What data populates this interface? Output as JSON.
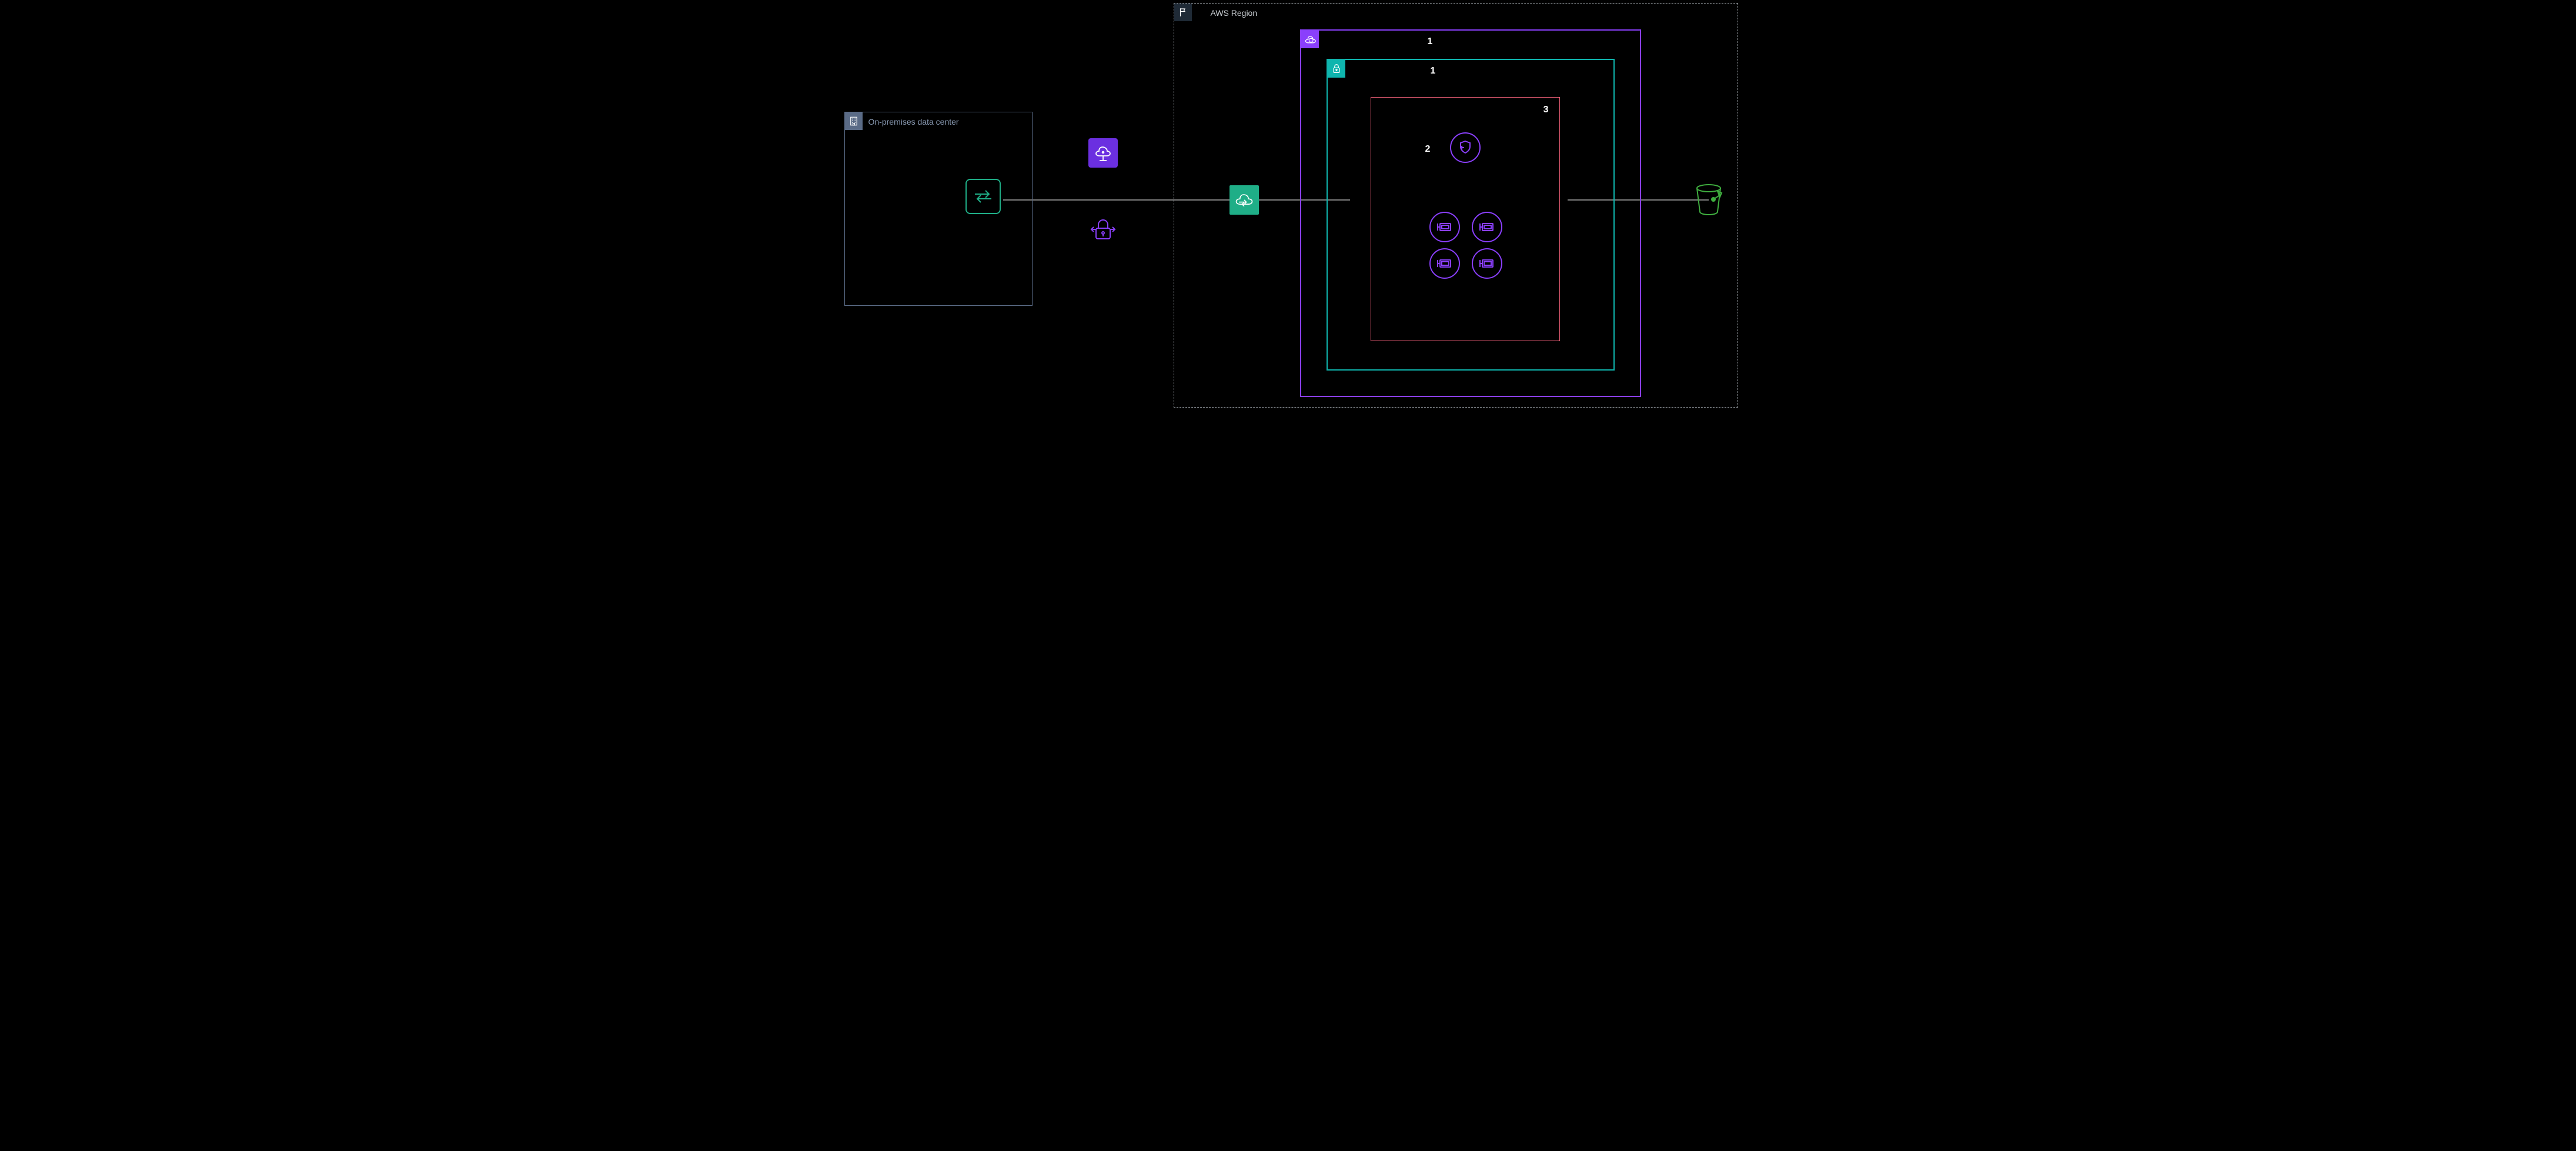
{
  "onprem": {
    "title": "On-premises data center"
  },
  "region": {
    "title": "AWS Region"
  },
  "nums": {
    "vpc": "1",
    "subnet": "1",
    "shield": "2",
    "ecs": "3"
  },
  "colors": {
    "onprem_border": "#5A6B86",
    "onprem_badge_bg": "#5A6B86",
    "onprem_text": "#8A9BB4",
    "region_border": "#9AA0A6",
    "region_badge_bg": "#1F2A36",
    "region_text": "#C7CCD1",
    "vpc_border": "#8A3FFC",
    "vpc_badge_bg": "#8A3FFC",
    "subnet_border": "#0FB5AE",
    "subnet_badge_bg": "#0FB5AE",
    "ecs_border": "#E85D75",
    "line": "#FFFFFF",
    "s3_stroke": "#3FAE3F",
    "router_stroke": "#1FAE87",
    "purple": "#8A3FFC",
    "gateway_bg": "#1FAE87"
  }
}
